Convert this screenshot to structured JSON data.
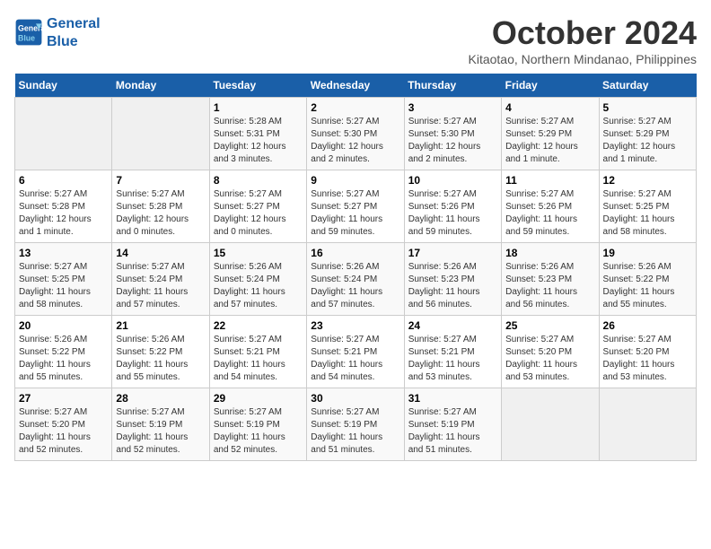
{
  "logo": {
    "line1": "General",
    "line2": "Blue"
  },
  "title": "October 2024",
  "location": "Kitaotao, Northern Mindanao, Philippines",
  "days_header": [
    "Sunday",
    "Monday",
    "Tuesday",
    "Wednesday",
    "Thursday",
    "Friday",
    "Saturday"
  ],
  "weeks": [
    [
      {
        "day": "",
        "info": ""
      },
      {
        "day": "",
        "info": ""
      },
      {
        "day": "1",
        "info": "Sunrise: 5:28 AM\nSunset: 5:31 PM\nDaylight: 12 hours\nand 3 minutes."
      },
      {
        "day": "2",
        "info": "Sunrise: 5:27 AM\nSunset: 5:30 PM\nDaylight: 12 hours\nand 2 minutes."
      },
      {
        "day": "3",
        "info": "Sunrise: 5:27 AM\nSunset: 5:30 PM\nDaylight: 12 hours\nand 2 minutes."
      },
      {
        "day": "4",
        "info": "Sunrise: 5:27 AM\nSunset: 5:29 PM\nDaylight: 12 hours\nand 1 minute."
      },
      {
        "day": "5",
        "info": "Sunrise: 5:27 AM\nSunset: 5:29 PM\nDaylight: 12 hours\nand 1 minute."
      }
    ],
    [
      {
        "day": "6",
        "info": "Sunrise: 5:27 AM\nSunset: 5:28 PM\nDaylight: 12 hours\nand 1 minute."
      },
      {
        "day": "7",
        "info": "Sunrise: 5:27 AM\nSunset: 5:28 PM\nDaylight: 12 hours\nand 0 minutes."
      },
      {
        "day": "8",
        "info": "Sunrise: 5:27 AM\nSunset: 5:27 PM\nDaylight: 12 hours\nand 0 minutes."
      },
      {
        "day": "9",
        "info": "Sunrise: 5:27 AM\nSunset: 5:27 PM\nDaylight: 11 hours\nand 59 minutes."
      },
      {
        "day": "10",
        "info": "Sunrise: 5:27 AM\nSunset: 5:26 PM\nDaylight: 11 hours\nand 59 minutes."
      },
      {
        "day": "11",
        "info": "Sunrise: 5:27 AM\nSunset: 5:26 PM\nDaylight: 11 hours\nand 59 minutes."
      },
      {
        "day": "12",
        "info": "Sunrise: 5:27 AM\nSunset: 5:25 PM\nDaylight: 11 hours\nand 58 minutes."
      }
    ],
    [
      {
        "day": "13",
        "info": "Sunrise: 5:27 AM\nSunset: 5:25 PM\nDaylight: 11 hours\nand 58 minutes."
      },
      {
        "day": "14",
        "info": "Sunrise: 5:27 AM\nSunset: 5:24 PM\nDaylight: 11 hours\nand 57 minutes."
      },
      {
        "day": "15",
        "info": "Sunrise: 5:26 AM\nSunset: 5:24 PM\nDaylight: 11 hours\nand 57 minutes."
      },
      {
        "day": "16",
        "info": "Sunrise: 5:26 AM\nSunset: 5:24 PM\nDaylight: 11 hours\nand 57 minutes."
      },
      {
        "day": "17",
        "info": "Sunrise: 5:26 AM\nSunset: 5:23 PM\nDaylight: 11 hours\nand 56 minutes."
      },
      {
        "day": "18",
        "info": "Sunrise: 5:26 AM\nSunset: 5:23 PM\nDaylight: 11 hours\nand 56 minutes."
      },
      {
        "day": "19",
        "info": "Sunrise: 5:26 AM\nSunset: 5:22 PM\nDaylight: 11 hours\nand 55 minutes."
      }
    ],
    [
      {
        "day": "20",
        "info": "Sunrise: 5:26 AM\nSunset: 5:22 PM\nDaylight: 11 hours\nand 55 minutes."
      },
      {
        "day": "21",
        "info": "Sunrise: 5:26 AM\nSunset: 5:22 PM\nDaylight: 11 hours\nand 55 minutes."
      },
      {
        "day": "22",
        "info": "Sunrise: 5:27 AM\nSunset: 5:21 PM\nDaylight: 11 hours\nand 54 minutes."
      },
      {
        "day": "23",
        "info": "Sunrise: 5:27 AM\nSunset: 5:21 PM\nDaylight: 11 hours\nand 54 minutes."
      },
      {
        "day": "24",
        "info": "Sunrise: 5:27 AM\nSunset: 5:21 PM\nDaylight: 11 hours\nand 53 minutes."
      },
      {
        "day": "25",
        "info": "Sunrise: 5:27 AM\nSunset: 5:20 PM\nDaylight: 11 hours\nand 53 minutes."
      },
      {
        "day": "26",
        "info": "Sunrise: 5:27 AM\nSunset: 5:20 PM\nDaylight: 11 hours\nand 53 minutes."
      }
    ],
    [
      {
        "day": "27",
        "info": "Sunrise: 5:27 AM\nSunset: 5:20 PM\nDaylight: 11 hours\nand 52 minutes."
      },
      {
        "day": "28",
        "info": "Sunrise: 5:27 AM\nSunset: 5:19 PM\nDaylight: 11 hours\nand 52 minutes."
      },
      {
        "day": "29",
        "info": "Sunrise: 5:27 AM\nSunset: 5:19 PM\nDaylight: 11 hours\nand 52 minutes."
      },
      {
        "day": "30",
        "info": "Sunrise: 5:27 AM\nSunset: 5:19 PM\nDaylight: 11 hours\nand 51 minutes."
      },
      {
        "day": "31",
        "info": "Sunrise: 5:27 AM\nSunset: 5:19 PM\nDaylight: 11 hours\nand 51 minutes."
      },
      {
        "day": "",
        "info": ""
      },
      {
        "day": "",
        "info": ""
      }
    ]
  ]
}
